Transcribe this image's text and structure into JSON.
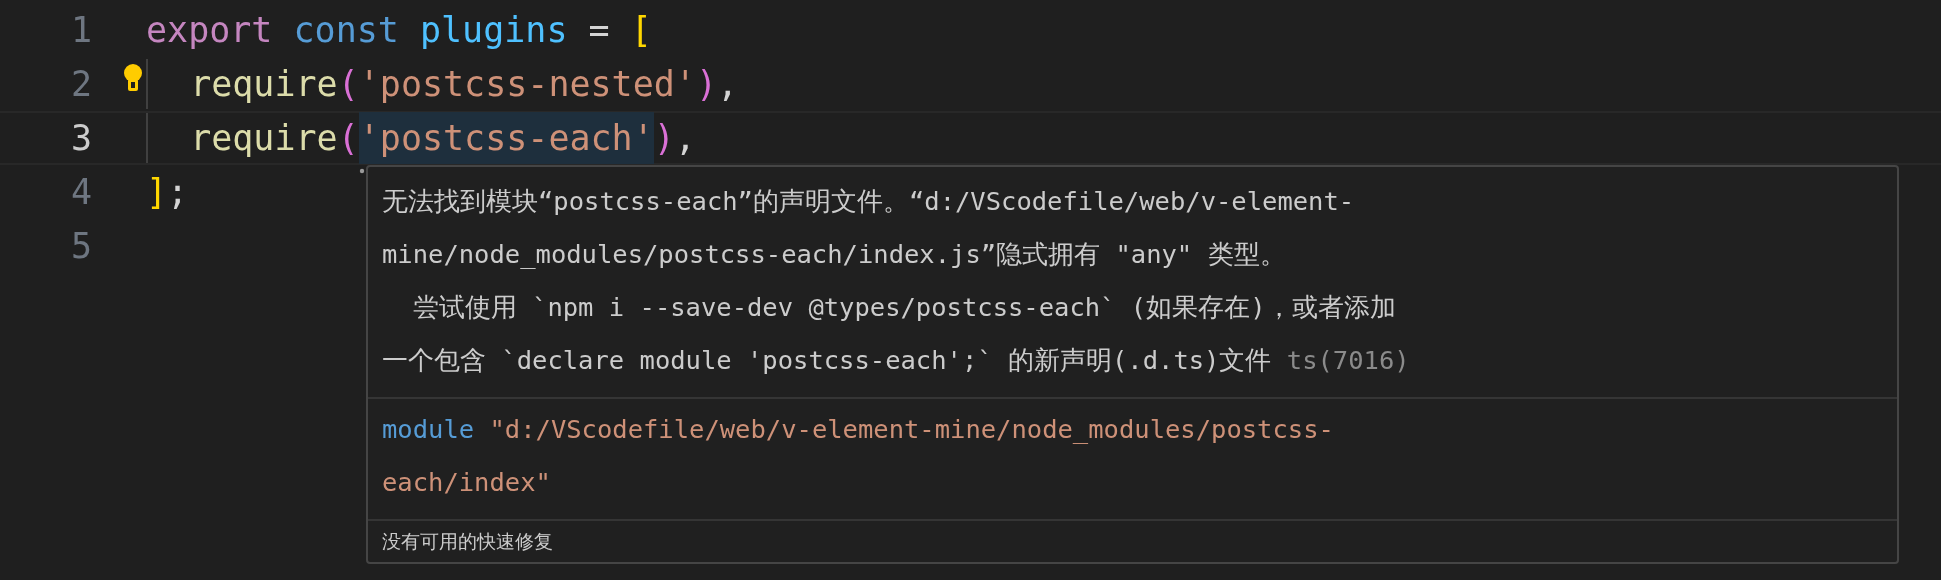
{
  "editor": {
    "lines": [
      {
        "number": "1",
        "current": false,
        "lightbulb": false,
        "tokens": [
          {
            "kind": "keyword",
            "text": "export",
            "highlighted": false
          },
          {
            "kind": "storage",
            "text": " const",
            "highlighted": false
          },
          {
            "kind": "variable",
            "text": " plugins",
            "highlighted": false
          },
          {
            "kind": "plain",
            "text": " = ",
            "highlighted": false
          },
          {
            "kind": "bracket",
            "text": "[",
            "highlighted": false
          }
        ]
      },
      {
        "number": "2",
        "current": false,
        "lightbulb": true,
        "tokens": [
          {
            "kind": "function",
            "text": "  require",
            "highlighted": false
          },
          {
            "kind": "paren",
            "text": "(",
            "highlighted": false
          },
          {
            "kind": "string",
            "text": "'postcss-nested'",
            "highlighted": false
          },
          {
            "kind": "paren",
            "text": ")",
            "highlighted": false
          },
          {
            "kind": "plain",
            "text": ",",
            "highlighted": false
          }
        ]
      },
      {
        "number": "3",
        "current": true,
        "lightbulb": false,
        "tokens": [
          {
            "kind": "function",
            "text": "  require",
            "highlighted": false
          },
          {
            "kind": "paren",
            "text": "(",
            "highlighted": false
          },
          {
            "kind": "string",
            "text": "'postcss-each'",
            "highlighted": true
          },
          {
            "kind": "paren",
            "text": ")",
            "highlighted": false
          },
          {
            "kind": "plain",
            "text": ",",
            "highlighted": false
          }
        ]
      },
      {
        "number": "4",
        "current": false,
        "lightbulb": false,
        "tokens": [
          {
            "kind": "bracket",
            "text": "]",
            "highlighted": false
          },
          {
            "kind": "plain",
            "text": ";",
            "highlighted": false
          }
        ]
      },
      {
        "number": "5",
        "current": false,
        "lightbulb": false
      }
    ]
  },
  "hover": {
    "message_lines": [
      "无法找到模块“postcss-each”的声明文件。“d:/VScodefile/web/v-element-",
      "mine/node_modules/postcss-each/index.js”隐式拥有 \"any\" 类型。",
      "  尝试使用 `npm i --save-dev @types/postcss-each` (如果存在)，或者添加",
      "一个包含 `declare module 'postcss-each';` 的新声明(.d.ts)文件"
    ],
    "error_code": "ts(7016)",
    "signature_lines": [
      [
        {
          "kind": "storage",
          "text": "module"
        },
        {
          "kind": "string",
          "text": " \"d:/VScodefile/web/v-element-mine/node_modules/postcss-"
        }
      ],
      [
        {
          "kind": "string",
          "text": "each/index\""
        }
      ]
    ],
    "status": "没有可用的快速修复"
  }
}
